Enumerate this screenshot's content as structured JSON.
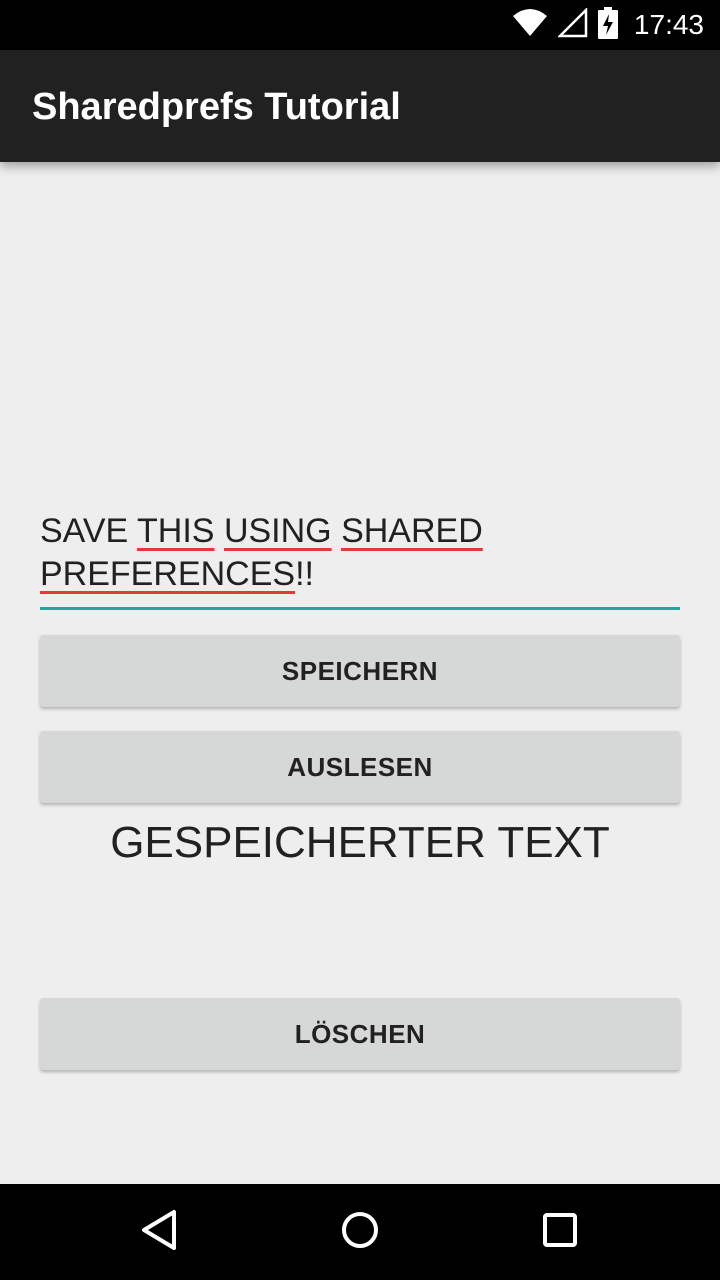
{
  "status_bar": {
    "time": "17:43",
    "icons": [
      "wifi-icon",
      "cell-signal-icon",
      "battery-charging-icon"
    ]
  },
  "app_bar": {
    "title": "Sharedprefs Tutorial"
  },
  "input": {
    "line1": {
      "w1": "SAVE",
      "w2": "THIS",
      "w3": "USING",
      "w4": "SHARED"
    },
    "line2": {
      "w1": "PREFERENCES",
      "w2": "!!"
    }
  },
  "buttons": {
    "save_label": "SPEICHERN",
    "read_label": "AUSLESEN",
    "delete_label": "LÖSCHEN"
  },
  "output": {
    "saved_text": "GESPEICHERTER TEXT"
  },
  "nav_bar": {
    "icons": [
      "back-icon",
      "home-icon",
      "recents-icon"
    ]
  },
  "colors": {
    "app_bar": "#212121",
    "status_bar": "#000000",
    "background": "#eeeeee",
    "accent": "#26a69a",
    "spell_underline": "#e53935",
    "button": "#d6d7d7"
  }
}
